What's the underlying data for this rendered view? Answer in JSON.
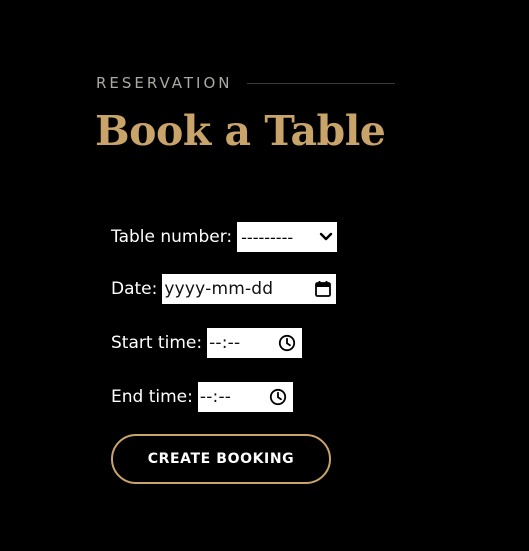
{
  "header": {
    "eyebrow": "RESERVATION",
    "title": "Book a Table"
  },
  "form": {
    "table_number": {
      "label": "Table number:",
      "selected_value": "---------",
      "icon": "chevron-down-icon"
    },
    "date": {
      "label": "Date:",
      "placeholder": "yyyy-mm-dd",
      "icon": "calendar-icon"
    },
    "start_time": {
      "label": "Start time:",
      "placeholder": "--:--",
      "icon": "clock-icon"
    },
    "end_time": {
      "label": "End time:",
      "placeholder": "--:--",
      "icon": "clock-icon"
    },
    "submit_label": "CREATE BOOKING"
  },
  "colors": {
    "background": "#000000",
    "accent_gold": "#c9a46a",
    "eyebrow_gray": "#aaa9a3",
    "text": "#ffffff"
  }
}
